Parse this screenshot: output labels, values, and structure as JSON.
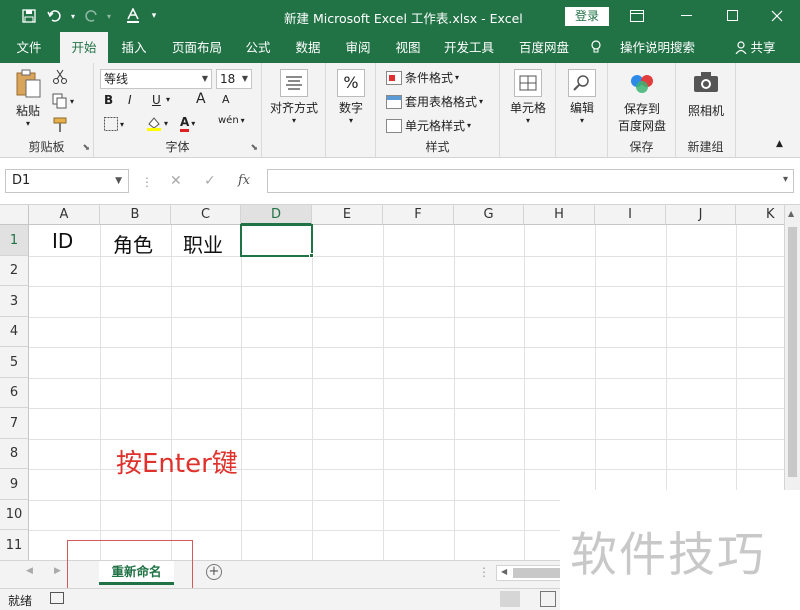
{
  "window": {
    "title": "新建 Microsoft Excel 工作表.xlsx  -  Excel",
    "login_label": "登录"
  },
  "ribbon_tabs": [
    "文件",
    "开始",
    "插入",
    "页面布局",
    "公式",
    "数据",
    "审阅",
    "视图",
    "开发工具",
    "百度网盘"
  ],
  "active_tab": "开始",
  "tell_me": "操作说明搜索",
  "share_label": "共享",
  "ribbon": {
    "clipboard": {
      "paste": "粘贴",
      "label": "剪贴板"
    },
    "font": {
      "name": "等线",
      "size": "18",
      "label": "字体",
      "bold": "B",
      "italic": "I",
      "underline": "U",
      "grow": "A",
      "shrink": "A",
      "font_color": "A",
      "wen": "wén"
    },
    "align": {
      "label": "对齐方式"
    },
    "number": {
      "label": "数字",
      "symbol": "%"
    },
    "styles": {
      "conditional": "条件格式",
      "table": "套用表格格式",
      "cell_styles": "单元格样式",
      "label": "样式"
    },
    "cells": {
      "label": "单元格"
    },
    "editing": {
      "label": "编辑"
    },
    "save": {
      "line1": "保存到",
      "line2": "百度网盘",
      "label": "保存"
    },
    "camera": {
      "label": "照相机",
      "group": "新建组"
    }
  },
  "formula_bar": {
    "name_box": "D1",
    "fx": "fx",
    "value": ""
  },
  "columns": [
    "A",
    "B",
    "C",
    "D",
    "E",
    "F",
    "G",
    "H",
    "I",
    "J",
    "K"
  ],
  "rows": [
    "1",
    "2",
    "3",
    "4",
    "5",
    "6",
    "7",
    "8",
    "9",
    "10",
    "11"
  ],
  "cells": {
    "A1": "ID",
    "B1": "角色",
    "C1": "职业"
  },
  "active_cell": "D1",
  "annotation": "按Enter键",
  "sheet_tab": "重新命名",
  "status": {
    "ready": "就绪"
  },
  "watermark": "软件技巧",
  "colors": {
    "accent": "#217346",
    "annotation": "#e0322d"
  }
}
